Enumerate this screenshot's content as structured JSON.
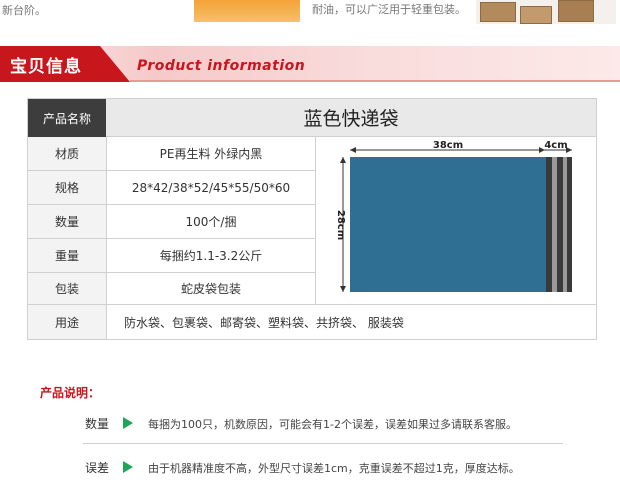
{
  "top_strip": {
    "left_text": "新台阶。",
    "mid_text": "耐油，可以广泛用于轻重包装。"
  },
  "banner": {
    "title": "宝贝信息",
    "subtitle": "Product information"
  },
  "spec_table": {
    "header_label": "产品名称",
    "header_value": "蓝色快递袋",
    "rows": [
      {
        "label": "材质",
        "value": "PE再生料 外绿内黑"
      },
      {
        "label": "规格",
        "value": "28*42/38*52/45*55/50*60"
      },
      {
        "label": "数量",
        "value": "100个/捆"
      },
      {
        "label": "重量",
        "value": "每捆约1.1-3.2公斤"
      },
      {
        "label": "包装",
        "value": "蛇皮袋包装"
      }
    ],
    "use_label": "用途",
    "use_value": "防水袋、包裹袋、邮寄袋、塑料袋、共挤袋、 服装袋"
  },
  "diagram": {
    "width_label": "38cm",
    "flap_label": "4cm",
    "height_label": "28cm",
    "bag_color": "#2f6f94",
    "flap_colors": [
      "#3a3a3a",
      "#9a9a9a"
    ]
  },
  "description": {
    "title": "产品说明：",
    "items": [
      {
        "label": "数量",
        "text": "每捆为100只，机数原因，可能会有1-2个误差，误差如果过多请联系客服。"
      },
      {
        "label": "误差",
        "text": "由于机器精准度不高，外型尺寸误差1cm，克重误差不超过1克，厚度达标。"
      }
    ]
  },
  "colors": {
    "accent_red": "#c8161d",
    "arrow_green": "#1fa55a"
  }
}
